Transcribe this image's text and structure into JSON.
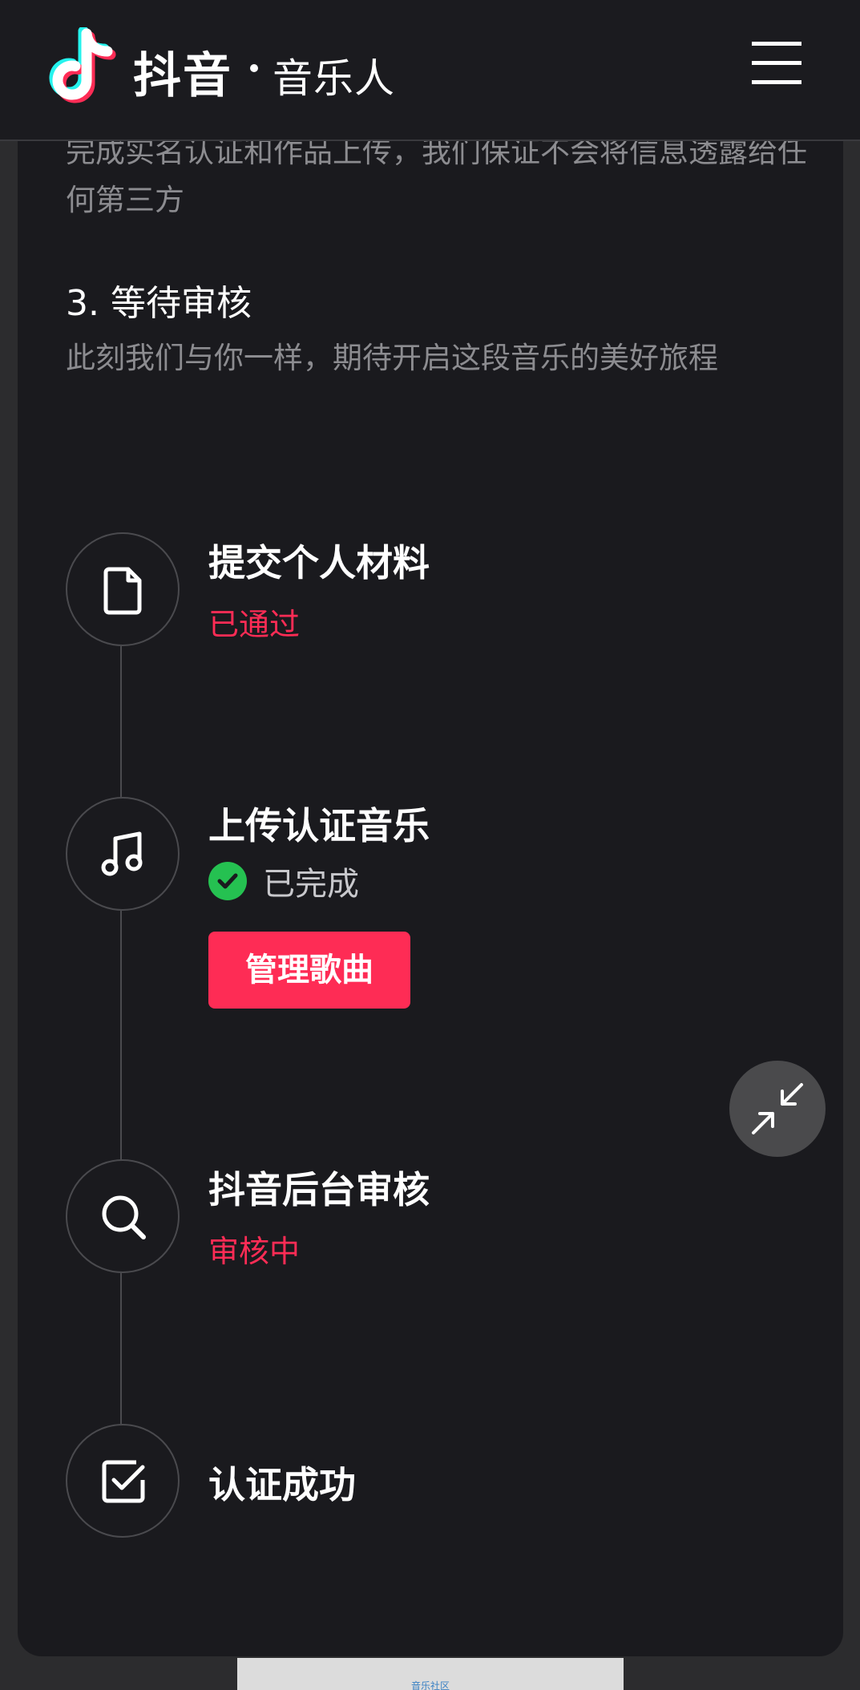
{
  "header": {
    "logo_main": "抖音",
    "logo_sub": "音乐人"
  },
  "intro": {
    "text": "完成实名认证和作品上传，我们保证不会将信息透露给任何第三方"
  },
  "step3": {
    "title": "3. 等待审核",
    "description": "此刻我们与你一样，期待开启这段音乐的美好旅程"
  },
  "timeline": {
    "items": [
      {
        "title": "提交个人材料",
        "status": "已通过",
        "icon": "document-icon"
      },
      {
        "title": "上传认证音乐",
        "status": "已完成",
        "icon": "music-note-icon",
        "button": "管理歌曲"
      },
      {
        "title": "抖音后台审核",
        "status": "审核中",
        "icon": "search-icon"
      },
      {
        "title": "认证成功",
        "status": "",
        "icon": "checkbox-icon"
      }
    ]
  },
  "footer": {
    "peek_text": "音乐社区"
  },
  "colors": {
    "accent": "#fe2c55",
    "success": "#25c151",
    "background": "#1a1a1e"
  }
}
